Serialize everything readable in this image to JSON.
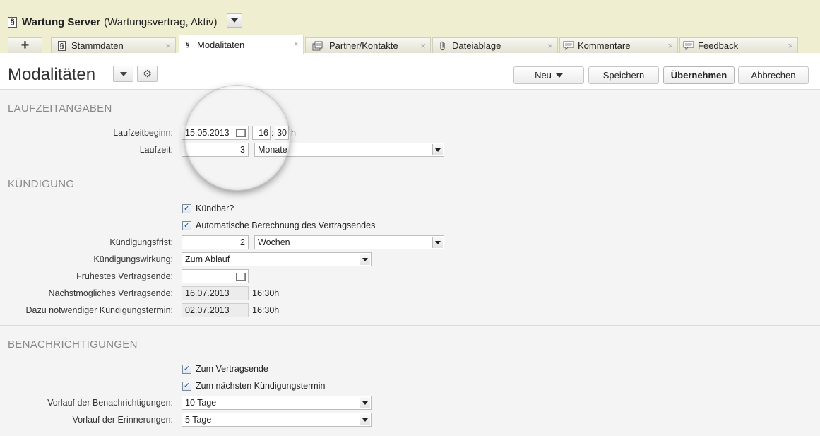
{
  "window": {
    "title_strong": "Wartung Server",
    "title_rest": "(Wartungsvertrag, Aktiv)",
    "doc_icon": "section-sign-icon"
  },
  "tabs": [
    {
      "label": "+",
      "icon": "plus-icon"
    },
    {
      "label": "Stammdaten",
      "icon": "section-sign-icon"
    },
    {
      "label": "Modalitäten",
      "icon": "section-sign-icon",
      "active": true
    },
    {
      "label": "Partner/Kontakte",
      "icon": "contacts-icon"
    },
    {
      "label": "Dateiablage",
      "icon": "paperclip-icon"
    },
    {
      "label": "Kommentare",
      "icon": "speech-bubble-icon"
    },
    {
      "label": "Feedback",
      "icon": "speech-bubble-icon"
    }
  ],
  "tab_close_glyph": "×",
  "header": {
    "page_title": "Modalitäten",
    "buttons": {
      "neu": "Neu",
      "speichern": "Speichern",
      "uebernehmen": "Übernehmen",
      "abbrechen": "Abbrechen"
    }
  },
  "laufzeit": {
    "title": "LAUFZEITANGABEN",
    "beginn_label": "Laufzeitbeginn:",
    "beginn_date": "15.05.2013",
    "beginn_hour": "16",
    "beginn_minute": "30",
    "time_sep": ":",
    "time_unit": "h",
    "laufzeit_label": "Laufzeit:",
    "laufzeit_value": "3",
    "laufzeit_unit": "Monate"
  },
  "kuendigung": {
    "title": "KÜNDIGUNG",
    "kuendbar_label": "Kündbar?",
    "kuendbar_checked": true,
    "auto_label": "Automatische Berechnung des Vertragsendes",
    "auto_checked": true,
    "frist_label": "Kündigungsfrist:",
    "frist_value": "2",
    "frist_unit": "Wochen",
    "wirkung_label": "Kündigungswirkung:",
    "wirkung_value": "Zum Ablauf",
    "fruehestes_label": "Frühestes Vertragsende:",
    "fruehestes_value": "",
    "naechst_label": "Nächstmögliches Vertragsende:",
    "naechst_date": "16.07.2013",
    "naechst_time": "16:30h",
    "termin_label": "Dazu notwendiger Kündigungstermin:",
    "termin_date": "02.07.2013",
    "termin_time": "16:30h"
  },
  "benachrichtigungen": {
    "title": "BENACHRICHTIGUNGEN",
    "vertragsende_label": "Zum Vertragsende",
    "vertragsende_checked": true,
    "kuendigungstermin_label": "Zum nächsten Kündigungstermin",
    "kuendigungstermin_checked": true,
    "vorlauf_benachr_label": "Vorlauf der Benachrichtigungen:",
    "vorlauf_benachr_value": "10 Tage",
    "vorlauf_erinn_label": "Vorlauf der Erinnerungen:",
    "vorlauf_erinn_value": "5 Tage"
  },
  "check_glyph": "✓",
  "gear_glyph": "⚙"
}
